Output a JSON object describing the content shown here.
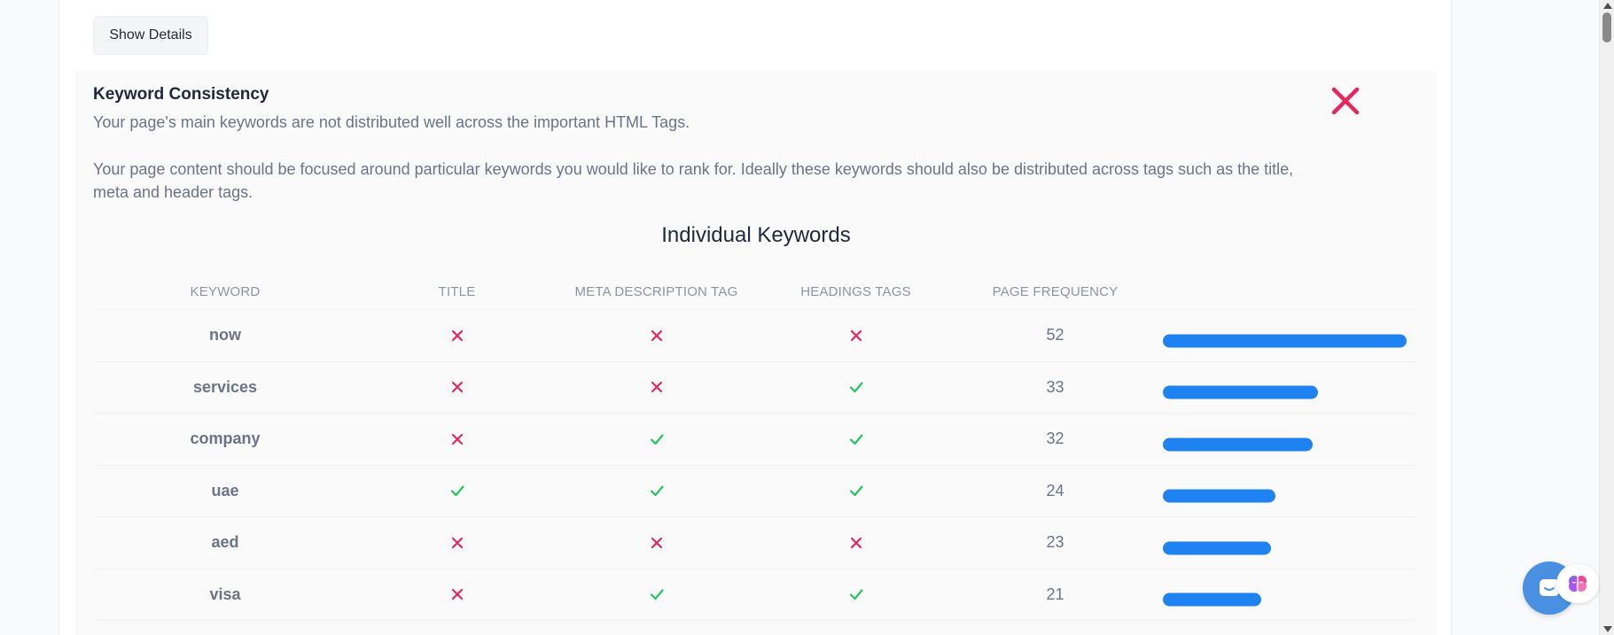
{
  "toolbar": {
    "show_details_label": "Show Details"
  },
  "section": {
    "title": "Keyword Consistency",
    "summary": "Your page's main keywords are not distributed well across the important HTML Tags.",
    "description": "Your page content should be focused around particular keywords you would like to rank for. Ideally these keywords should also be distributed across tags such as the title, meta and header tags.",
    "status_icon": "fail-x-icon",
    "status_color": "#e8265e"
  },
  "table": {
    "title": "Individual Keywords",
    "headers": {
      "keyword": "KEYWORD",
      "title": "TITLE",
      "meta": "META DESCRIPTION TAG",
      "headings": "HEADINGS TAGS",
      "frequency": "PAGE FREQUENCY"
    },
    "rows": [
      {
        "keyword": "now",
        "title": false,
        "meta": false,
        "headings": false,
        "frequency": "52",
        "bar_fraction": 1.0
      },
      {
        "keyword": "services",
        "title": false,
        "meta": false,
        "headings": true,
        "frequency": "33",
        "bar_fraction": 0.635
      },
      {
        "keyword": "company",
        "title": false,
        "meta": true,
        "headings": true,
        "frequency": "32",
        "bar_fraction": 0.615
      },
      {
        "keyword": "uae",
        "title": true,
        "meta": true,
        "headings": true,
        "frequency": "24",
        "bar_fraction": 0.462
      },
      {
        "keyword": "aed",
        "title": false,
        "meta": false,
        "headings": false,
        "frequency": "23",
        "bar_fraction": 0.442
      },
      {
        "keyword": "visa",
        "title": false,
        "meta": true,
        "headings": true,
        "frequency": "21",
        "bar_fraction": 0.404
      }
    ]
  },
  "colors": {
    "pass": "#22c55e",
    "fail": "#e8265e",
    "bar": "#1e83f0"
  }
}
